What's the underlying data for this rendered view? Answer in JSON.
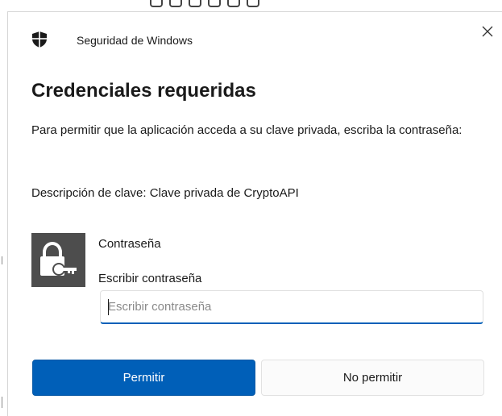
{
  "window": {
    "app_title": "Seguridad de Windows",
    "close_glyph": "✕"
  },
  "dialog": {
    "heading": "Credenciales requeridas",
    "message": "Para permitir que la aplicación acceda a su clave privada, escriba la contraseña:",
    "description": "Descripción de clave: Clave privada de CryptoAPI"
  },
  "credential": {
    "icon": "lock-key-icon",
    "field_label": "Contraseña",
    "input_label": "Escribir contraseña",
    "input_placeholder": "Escribir contraseña",
    "input_value": ""
  },
  "buttons": {
    "allow_label": "Permitir",
    "deny_label": "No permitir"
  },
  "colors": {
    "accent": "#005fb8",
    "icon_tile": "#4d4d4d"
  }
}
